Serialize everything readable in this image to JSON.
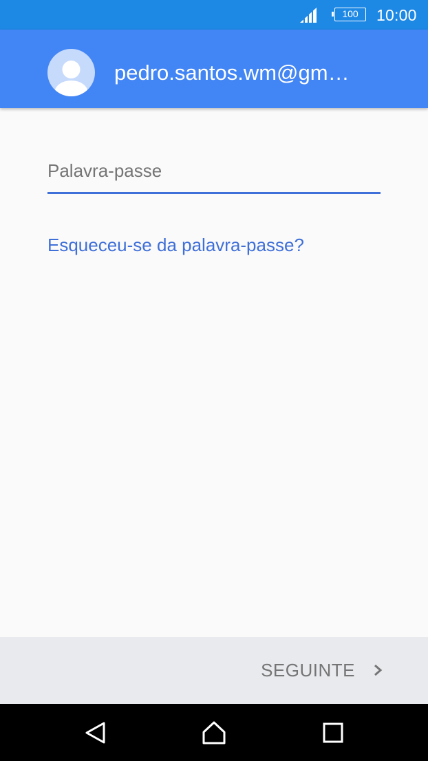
{
  "status_bar": {
    "battery": "100",
    "time": "10:00",
    "icons": [
      "signal-icon",
      "battery-icon"
    ]
  },
  "header": {
    "account_email": "pedro.santos.wm@gm…",
    "avatar_icon": "account-avatar-icon",
    "color": "#4285f4"
  },
  "form": {
    "password_placeholder": "Palavra-passe",
    "password_value": "",
    "forgot_link": "Esqueceu-se da palavra-passe?",
    "accent_color": "#3f6fd8"
  },
  "footer": {
    "next_label": "SEGUINTE",
    "next_icon": "chevron-right-icon"
  },
  "nav_bar": {
    "buttons": [
      "back-icon",
      "home-icon",
      "recents-icon"
    ]
  }
}
